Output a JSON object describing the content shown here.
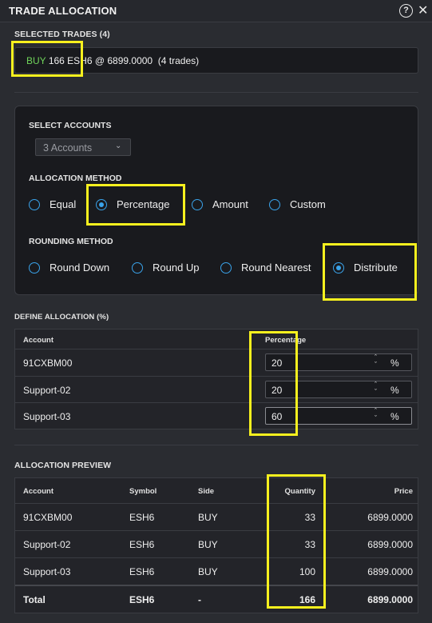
{
  "window": {
    "title": "TRADE ALLOCATION",
    "help_icon": "?",
    "close_icon": "✕"
  },
  "selected_trades": {
    "label": "SELECTED TRADES (4)",
    "side": "BUY",
    "summary": "166 ESH6 @ 6899.0000",
    "count": "(4 trades)"
  },
  "accounts": {
    "label": "SELECT ACCOUNTS",
    "dropdown_value": "3 Accounts"
  },
  "allocation_method": {
    "label": "ALLOCATION METHOD",
    "options": [
      "Equal",
      "Percentage",
      "Amount",
      "Custom"
    ],
    "selected": "Percentage"
  },
  "rounding_method": {
    "label": "ROUNDING METHOD",
    "options": [
      "Round Down",
      "Round Up",
      "Round Nearest",
      "Distribute"
    ],
    "selected": "Distribute"
  },
  "define_allocation": {
    "label": "DEFINE ALLOCATION (%)",
    "columns": [
      "Account",
      "Percentage"
    ],
    "unit": "%",
    "rows": [
      {
        "account": "91CXBM00",
        "percentage": "20"
      },
      {
        "account": "Support-02",
        "percentage": "20"
      },
      {
        "account": "Support-03",
        "percentage": "60"
      }
    ]
  },
  "preview": {
    "label": "ALLOCATION PREVIEW",
    "columns": [
      "Account",
      "Symbol",
      "Side",
      "Quantity",
      "Price"
    ],
    "rows": [
      {
        "account": "91CXBM00",
        "symbol": "ESH6",
        "side": "BUY",
        "quantity": "33",
        "price": "6899.0000"
      },
      {
        "account": "Support-02",
        "symbol": "ESH6",
        "side": "BUY",
        "quantity": "33",
        "price": "6899.0000"
      },
      {
        "account": "Support-03",
        "symbol": "ESH6",
        "side": "BUY",
        "quantity": "100",
        "price": "6899.0000"
      }
    ],
    "total": {
      "account": "Total",
      "symbol": "ESH6",
      "side": "-",
      "quantity": "166",
      "price": "6899.0000"
    }
  },
  "colors": {
    "accent": "#3aa3ea",
    "buy": "#6fd35a",
    "highlight": "#f7f01e",
    "panel": "#191a1e",
    "background": "#2a2c31"
  }
}
